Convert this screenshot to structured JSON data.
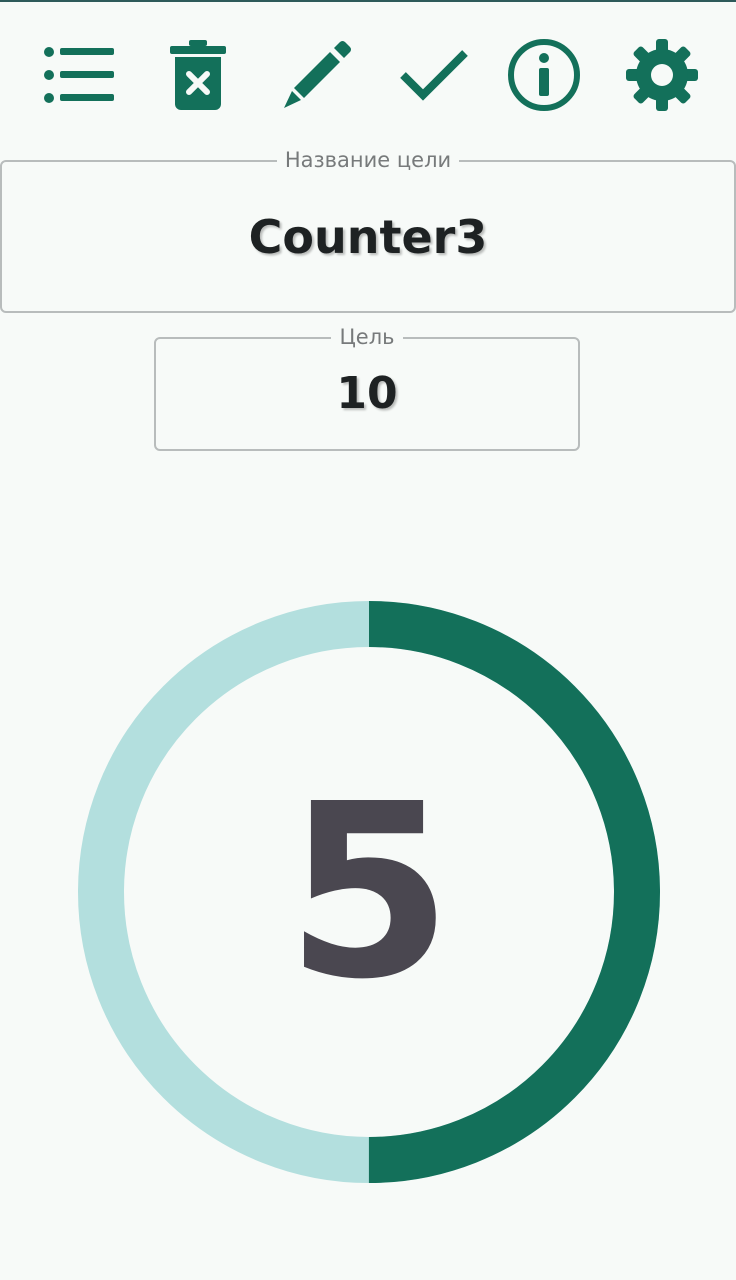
{
  "toolbar": {
    "items": [
      {
        "icon": "list-icon",
        "label": "list"
      },
      {
        "icon": "delete-icon",
        "label": "delete"
      },
      {
        "icon": "pencil-icon",
        "label": "edit"
      },
      {
        "icon": "check-icon",
        "label": "done"
      },
      {
        "icon": "info-icon",
        "label": "info"
      },
      {
        "icon": "gear-icon",
        "label": "settings"
      }
    ]
  },
  "goal": {
    "name_label": "Название цели",
    "name_value": "Counter3",
    "target_label": "Цель",
    "target_value": "10"
  },
  "counter": {
    "current": "5",
    "progress_fraction": 0.5
  },
  "colors": {
    "accent": "#13705a",
    "track": "#b3dfde",
    "number": "#4a4750",
    "background": "#f7faf8"
  }
}
